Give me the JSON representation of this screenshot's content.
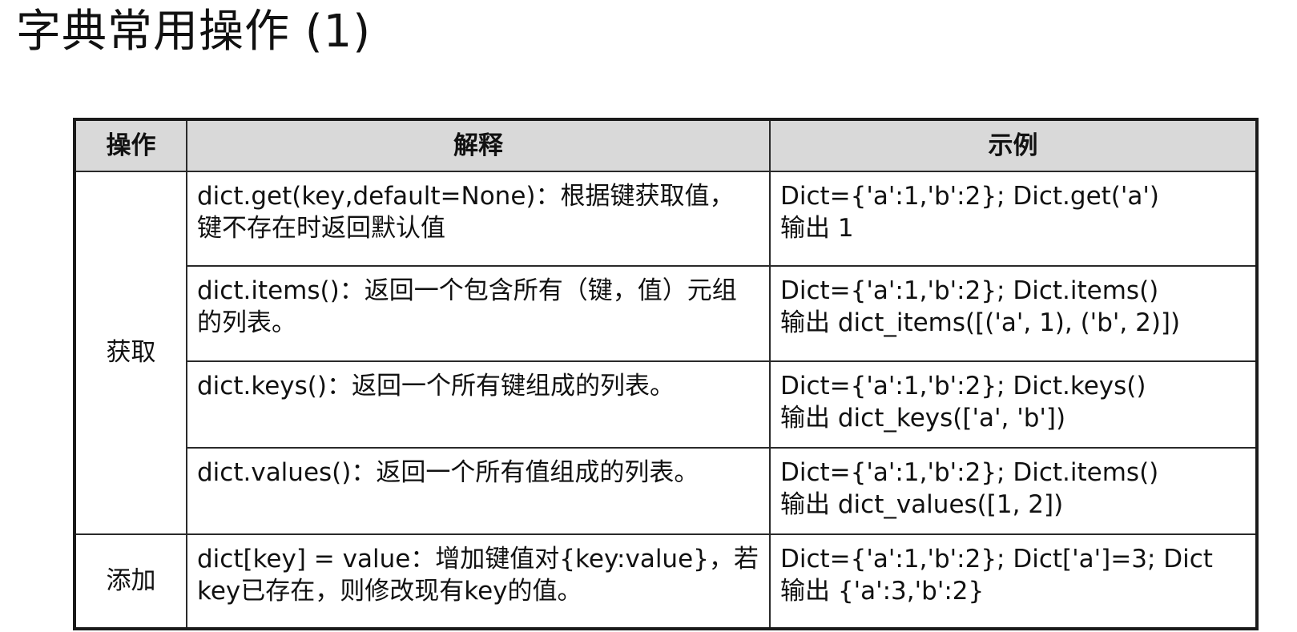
{
  "title": "字典常用操作 (1)",
  "table": {
    "headers": [
      "操作",
      "解释",
      "示例"
    ],
    "groups": [
      {
        "operation": "获取"
      },
      {
        "operation": "添加"
      }
    ],
    "rows": [
      {
        "description": [
          "dict.get(key,default=None)：根据键获取值，",
          "键不存在时返回默认值"
        ],
        "example": [
          "Dict={'a':1,'b':2}; Dict.get('a')",
          "输出 1"
        ]
      },
      {
        "description": [
          "dict.items()：返回一个包含所有（键，值）元组",
          "的列表。"
        ],
        "example": [
          "Dict={'a':1,'b':2}; Dict.items()",
          "输出 dict_items([('a', 1), ('b', 2)])"
        ]
      },
      {
        "description": [
          "dict.keys()：返回一个所有键组成的列表。"
        ],
        "example": [
          "Dict={'a':1,'b':2}; Dict.keys()",
          "输出  dict_keys(['a', 'b'])"
        ]
      },
      {
        "description": [
          "dict.values()：返回一个所有值组成的列表。"
        ],
        "example": [
          "Dict={'a':1,'b':2}; Dict.items()",
          "输出 dict_values([1, 2])"
        ]
      },
      {
        "description": [
          "dict[key] = value：增加键值对{key:value}，若",
          "key已存在，则修改现有key的值。"
        ],
        "example": [
          "Dict={'a':1,'b':2}; Dict['a']=3; Dict",
          "输出 {'a':3,'b':2}"
        ]
      }
    ]
  }
}
